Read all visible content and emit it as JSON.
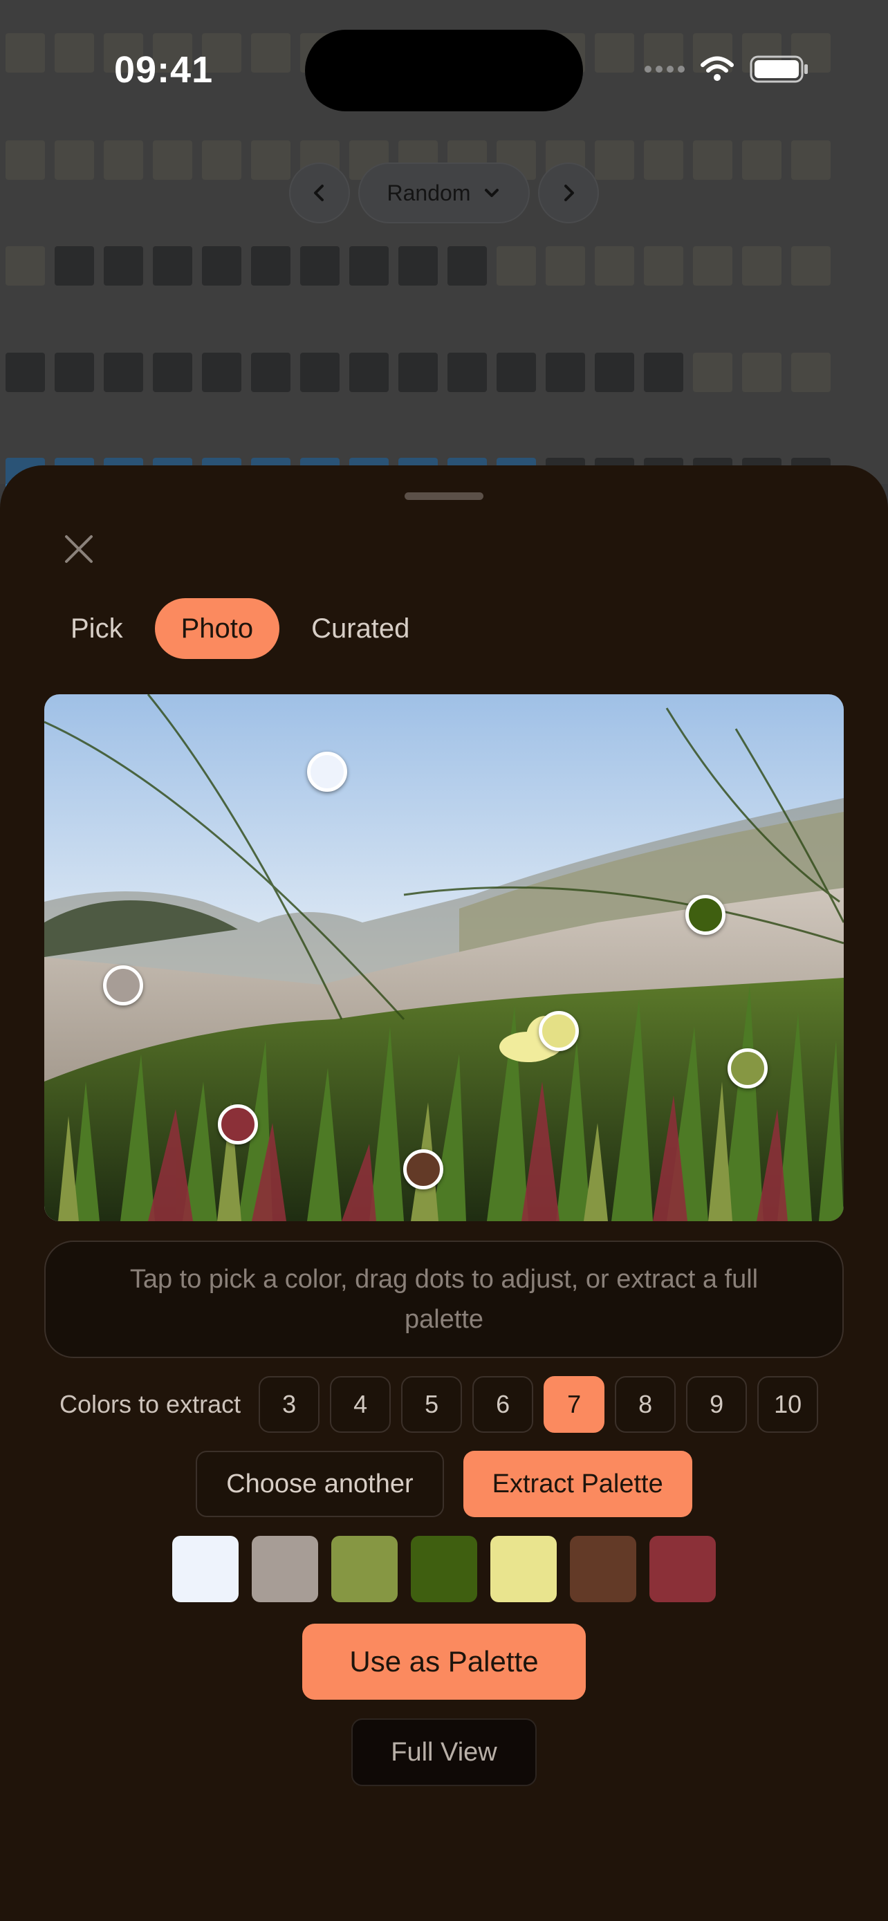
{
  "status_bar": {
    "time": "09:41"
  },
  "background": {
    "nav": {
      "prev_icon": "chevron-left-icon",
      "mode_label": "Random",
      "dropdown_icon": "chevron-down-icon",
      "next_icon": "chevron-right-icon"
    }
  },
  "sheet": {
    "close_icon": "close-icon",
    "tabs": [
      {
        "label": "Pick",
        "active": false
      },
      {
        "label": "Photo",
        "active": true
      },
      {
        "label": "Curated",
        "active": false
      }
    ],
    "photo": {
      "description_icon": "photo-image",
      "picker_dots": [
        {
          "color": "#eef3fc"
        },
        {
          "color": "#a79d96"
        },
        {
          "color": "#3f5f10"
        },
        {
          "color": "#e4e086"
        },
        {
          "color": "#869743"
        },
        {
          "color": "#8b3038"
        },
        {
          "color": "#633a27"
        }
      ]
    },
    "hint": "Tap to pick a color, drag dots to adjust, or extract a full palette",
    "extract_count": {
      "label": "Colors to extract",
      "options": [
        "3",
        "4",
        "5",
        "6",
        "7",
        "8",
        "9",
        "10"
      ],
      "selected": "7"
    },
    "buttons": {
      "choose_another": "Choose another",
      "extract": "Extract Palette",
      "use_palette": "Use as Palette",
      "full_view": "Full View"
    },
    "palette": [
      "#eef3fc",
      "#a79d96",
      "#869743",
      "#3f5f10",
      "#e9e48e",
      "#633a27",
      "#8b3038"
    ]
  },
  "colors": {
    "accent": "#fb8a5f",
    "sheet_bg": "#20140a"
  }
}
